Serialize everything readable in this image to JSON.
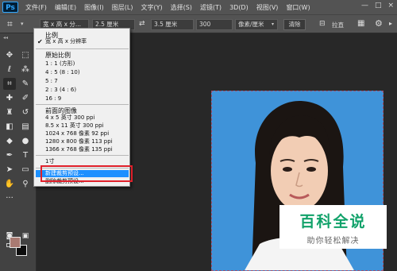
{
  "app": {
    "logo": "Ps"
  },
  "menu": [
    "文件(F)",
    "编辑(E)",
    "图像(I)",
    "图层(L)",
    "文字(Y)",
    "选择(S)",
    "滤镜(T)",
    "3D(D)",
    "视图(V)",
    "窗口(W)"
  ],
  "window_controls": {
    "minimize": "—",
    "maximize": "□",
    "close": "×"
  },
  "options_bar": {
    "ratio_select": "宽 x 高 x 分...",
    "width_value": "2.5 厘米",
    "height_value": "3.5 厘米",
    "resolution_value": "300",
    "resolution_unit": "像素/厘米",
    "clear_label": "清除",
    "straighten_label": "拉直"
  },
  "dropdown": {
    "section_ratio": "比例",
    "selected_item": "宽 x 高 x 分辨率",
    "original_ratio": "原始比例",
    "ratios": [
      "1 : 1 (方形)",
      "4 : 5 (8 : 10)",
      "5 : 7",
      "2 : 3 (4 : 6)",
      "16 : 9"
    ],
    "front_image": "前面的图像",
    "presets": [
      "4 x 5 英寸 300 ppi",
      "8.5 x 11 英寸 300 ppi",
      "1024 x 768 像素 92 ppi",
      "1280 x 800 像素 113 ppi",
      "1366 x 768 像素 135 ppi"
    ],
    "one_inch": "1寸",
    "new_preset": "新建裁剪预设...",
    "delete_preset": "删除裁剪预设..."
  },
  "watermark": {
    "title": "百科全说",
    "subtitle": "助你轻松解决"
  },
  "colors": {
    "foreground": "#a97a72",
    "background": "#0d0d0d",
    "photo_bg": "#3f93d9",
    "highlight": "#1e90ff",
    "red_box": "#e0202a",
    "watermark_green": "#11a26a"
  }
}
